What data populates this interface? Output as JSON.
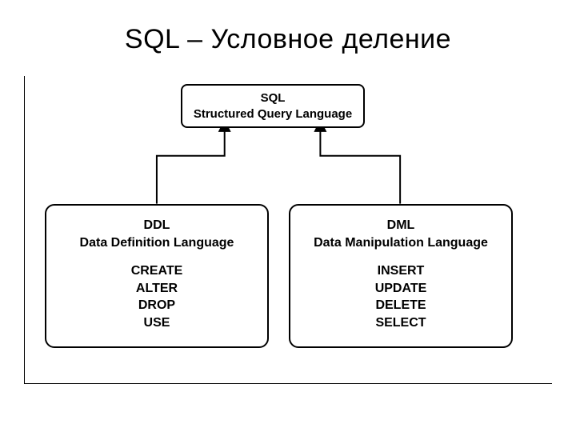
{
  "title": "SQL – Условное деление",
  "top": {
    "line1": "SQL",
    "line2": "Structured Query Language"
  },
  "left": {
    "title": "DDL",
    "subtitle": "Data Definition Language",
    "commands": [
      "CREATE",
      "ALTER",
      "DROP",
      "USE"
    ]
  },
  "right": {
    "title": "DML",
    "subtitle": "Data Manipulation Language",
    "commands": [
      "INSERT",
      "UPDATE",
      "DELETE",
      "SELECT"
    ]
  }
}
